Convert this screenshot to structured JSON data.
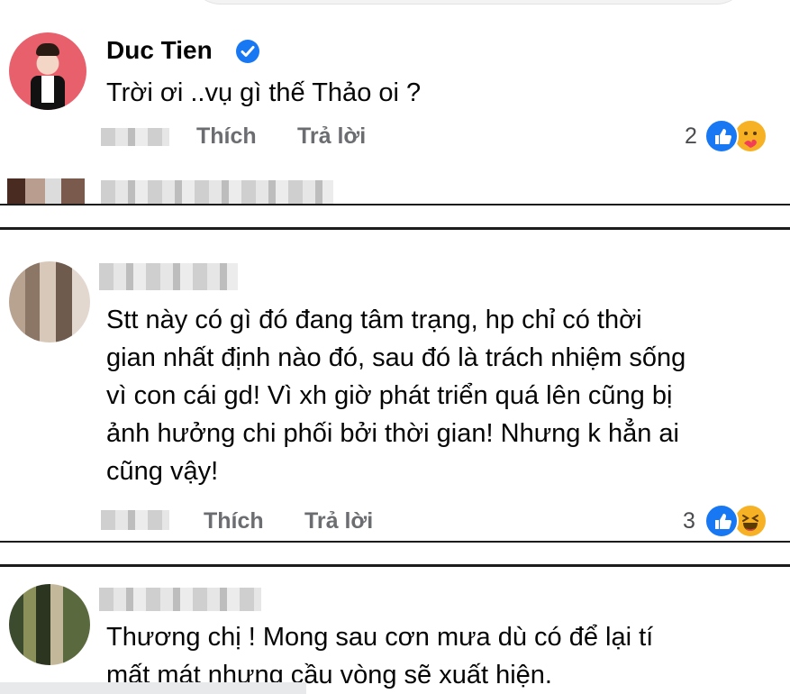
{
  "comments": [
    {
      "author": "Duc Tien",
      "text": "Trời ơi ..vụ gì thế Thảo oi ?",
      "like_label": "Thích",
      "reply_label": "Trả lời",
      "reaction_count": "2"
    },
    {
      "author": "",
      "text_lines": [
        "Stt này có gì đó đang tâm trạng, hp chỉ có thời",
        "gian nhất định nào đó, sau đó là trách nhiệm sống",
        "vì con cái gd! Vì xh giờ phát triển quá lên cũng bị",
        "ảnh hưởng chi phối bởi thời gian! Nhưng k hẳn ai",
        "cũng vậy!"
      ],
      "like_label": "Thích",
      "reply_label": "Trả lời",
      "reaction_count": "3"
    },
    {
      "author": "",
      "text_lines": [
        "Thương chị ! Mong sau cơn mưa dù có để lại tí",
        "mất mát nhưng cầu vòng sẽ xuất hiện."
      ]
    }
  ],
  "icons": {
    "verified": "verified-badge-icon",
    "like": "like-reaction-icon",
    "love_hug": "care-reaction-icon",
    "haha": "haha-reaction-icon"
  },
  "colors": {
    "like_blue": "#1877f2",
    "reaction_yellow": "#f7b125"
  }
}
